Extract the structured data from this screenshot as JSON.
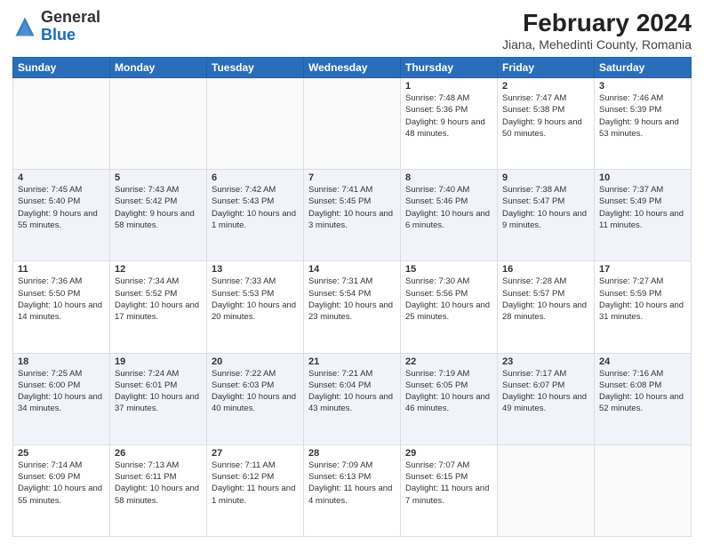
{
  "logo": {
    "general": "General",
    "blue": "Blue"
  },
  "title": "February 2024",
  "subtitle": "Jiana, Mehedinti County, Romania",
  "headers": [
    "Sunday",
    "Monday",
    "Tuesday",
    "Wednesday",
    "Thursday",
    "Friday",
    "Saturday"
  ],
  "rows": [
    [
      {
        "day": "",
        "text": ""
      },
      {
        "day": "",
        "text": ""
      },
      {
        "day": "",
        "text": ""
      },
      {
        "day": "",
        "text": ""
      },
      {
        "day": "1",
        "text": "Sunrise: 7:48 AM\nSunset: 5:36 PM\nDaylight: 9 hours and 48 minutes."
      },
      {
        "day": "2",
        "text": "Sunrise: 7:47 AM\nSunset: 5:38 PM\nDaylight: 9 hours and 50 minutes."
      },
      {
        "day": "3",
        "text": "Sunrise: 7:46 AM\nSunset: 5:39 PM\nDaylight: 9 hours and 53 minutes."
      }
    ],
    [
      {
        "day": "4",
        "text": "Sunrise: 7:45 AM\nSunset: 5:40 PM\nDaylight: 9 hours and 55 minutes."
      },
      {
        "day": "5",
        "text": "Sunrise: 7:43 AM\nSunset: 5:42 PM\nDaylight: 9 hours and 58 minutes."
      },
      {
        "day": "6",
        "text": "Sunrise: 7:42 AM\nSunset: 5:43 PM\nDaylight: 10 hours and 1 minute."
      },
      {
        "day": "7",
        "text": "Sunrise: 7:41 AM\nSunset: 5:45 PM\nDaylight: 10 hours and 3 minutes."
      },
      {
        "day": "8",
        "text": "Sunrise: 7:40 AM\nSunset: 5:46 PM\nDaylight: 10 hours and 6 minutes."
      },
      {
        "day": "9",
        "text": "Sunrise: 7:38 AM\nSunset: 5:47 PM\nDaylight: 10 hours and 9 minutes."
      },
      {
        "day": "10",
        "text": "Sunrise: 7:37 AM\nSunset: 5:49 PM\nDaylight: 10 hours and 11 minutes."
      }
    ],
    [
      {
        "day": "11",
        "text": "Sunrise: 7:36 AM\nSunset: 5:50 PM\nDaylight: 10 hours and 14 minutes."
      },
      {
        "day": "12",
        "text": "Sunrise: 7:34 AM\nSunset: 5:52 PM\nDaylight: 10 hours and 17 minutes."
      },
      {
        "day": "13",
        "text": "Sunrise: 7:33 AM\nSunset: 5:53 PM\nDaylight: 10 hours and 20 minutes."
      },
      {
        "day": "14",
        "text": "Sunrise: 7:31 AM\nSunset: 5:54 PM\nDaylight: 10 hours and 23 minutes."
      },
      {
        "day": "15",
        "text": "Sunrise: 7:30 AM\nSunset: 5:56 PM\nDaylight: 10 hours and 25 minutes."
      },
      {
        "day": "16",
        "text": "Sunrise: 7:28 AM\nSunset: 5:57 PM\nDaylight: 10 hours and 28 minutes."
      },
      {
        "day": "17",
        "text": "Sunrise: 7:27 AM\nSunset: 5:59 PM\nDaylight: 10 hours and 31 minutes."
      }
    ],
    [
      {
        "day": "18",
        "text": "Sunrise: 7:25 AM\nSunset: 6:00 PM\nDaylight: 10 hours and 34 minutes."
      },
      {
        "day": "19",
        "text": "Sunrise: 7:24 AM\nSunset: 6:01 PM\nDaylight: 10 hours and 37 minutes."
      },
      {
        "day": "20",
        "text": "Sunrise: 7:22 AM\nSunset: 6:03 PM\nDaylight: 10 hours and 40 minutes."
      },
      {
        "day": "21",
        "text": "Sunrise: 7:21 AM\nSunset: 6:04 PM\nDaylight: 10 hours and 43 minutes."
      },
      {
        "day": "22",
        "text": "Sunrise: 7:19 AM\nSunset: 6:05 PM\nDaylight: 10 hours and 46 minutes."
      },
      {
        "day": "23",
        "text": "Sunrise: 7:17 AM\nSunset: 6:07 PM\nDaylight: 10 hours and 49 minutes."
      },
      {
        "day": "24",
        "text": "Sunrise: 7:16 AM\nSunset: 6:08 PM\nDaylight: 10 hours and 52 minutes."
      }
    ],
    [
      {
        "day": "25",
        "text": "Sunrise: 7:14 AM\nSunset: 6:09 PM\nDaylight: 10 hours and 55 minutes."
      },
      {
        "day": "26",
        "text": "Sunrise: 7:13 AM\nSunset: 6:11 PM\nDaylight: 10 hours and 58 minutes."
      },
      {
        "day": "27",
        "text": "Sunrise: 7:11 AM\nSunset: 6:12 PM\nDaylight: 11 hours and 1 minute."
      },
      {
        "day": "28",
        "text": "Sunrise: 7:09 AM\nSunset: 6:13 PM\nDaylight: 11 hours and 4 minutes."
      },
      {
        "day": "29",
        "text": "Sunrise: 7:07 AM\nSunset: 6:15 PM\nDaylight: 11 hours and 7 minutes."
      },
      {
        "day": "",
        "text": ""
      },
      {
        "day": "",
        "text": ""
      }
    ]
  ]
}
